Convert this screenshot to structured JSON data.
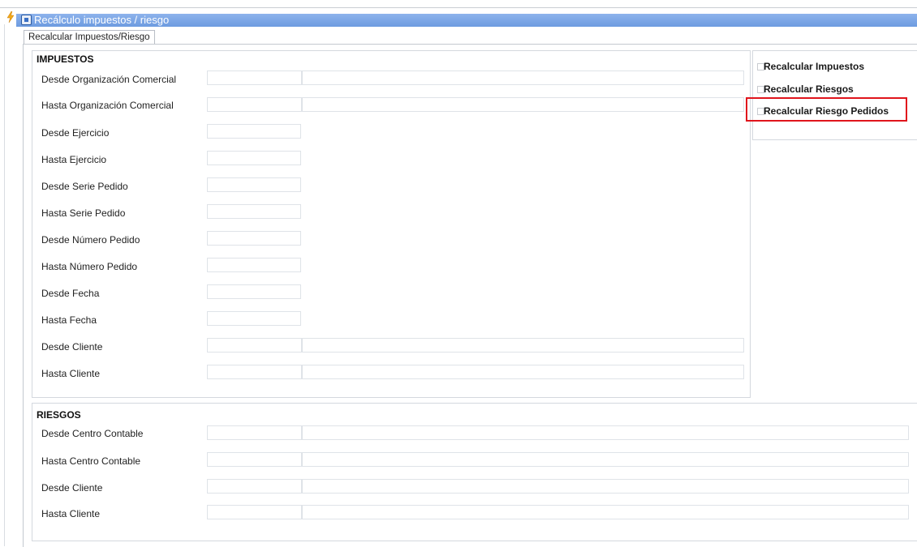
{
  "window": {
    "title": "Recálculo impuestos / riesgo",
    "tab_label": "Recalcular Impuestos/Riesgo"
  },
  "impuestos": {
    "title": "IMPUESTOS",
    "fields": [
      {
        "label": "Desde Organización Comercial",
        "value": "",
        "description": ""
      },
      {
        "label": "Hasta Organización Comercial",
        "value": "",
        "description": ""
      },
      {
        "label": "Desde Ejercicio",
        "value": ""
      },
      {
        "label": "Hasta Ejercicio",
        "value": ""
      },
      {
        "label": "Desde Serie Pedido",
        "value": ""
      },
      {
        "label": "Hasta Serie Pedido",
        "value": ""
      },
      {
        "label": "Desde Número Pedido",
        "value": ""
      },
      {
        "label": "Hasta Número Pedido",
        "value": ""
      },
      {
        "label": "Desde Fecha",
        "value": ""
      },
      {
        "label": "Hasta Fecha",
        "value": ""
      },
      {
        "label": "Desde Cliente",
        "value": "",
        "description": ""
      },
      {
        "label": "Hasta Cliente",
        "value": "",
        "description": ""
      }
    ]
  },
  "options": {
    "recalcular_impuestos": {
      "label": "Recalcular Impuestos",
      "checked": false
    },
    "recalcular_riesgos": {
      "label": "Recalcular Riesgos",
      "checked": false
    },
    "recalcular_riesgo_pedidos": {
      "label": "Recalcular Riesgo Pedidos",
      "checked": false
    }
  },
  "riesgos": {
    "title": "RIESGOS",
    "fields": [
      {
        "label": "Desde Centro Contable",
        "value": "",
        "description": ""
      },
      {
        "label": "Hasta Centro Contable",
        "value": "",
        "description": ""
      },
      {
        "label": "Desde Cliente",
        "value": "",
        "description": ""
      },
      {
        "label": "Hasta Cliente",
        "value": "",
        "description": ""
      }
    ]
  },
  "colors": {
    "title_bar": "#7aa6e6",
    "highlight": "#e0141c"
  }
}
